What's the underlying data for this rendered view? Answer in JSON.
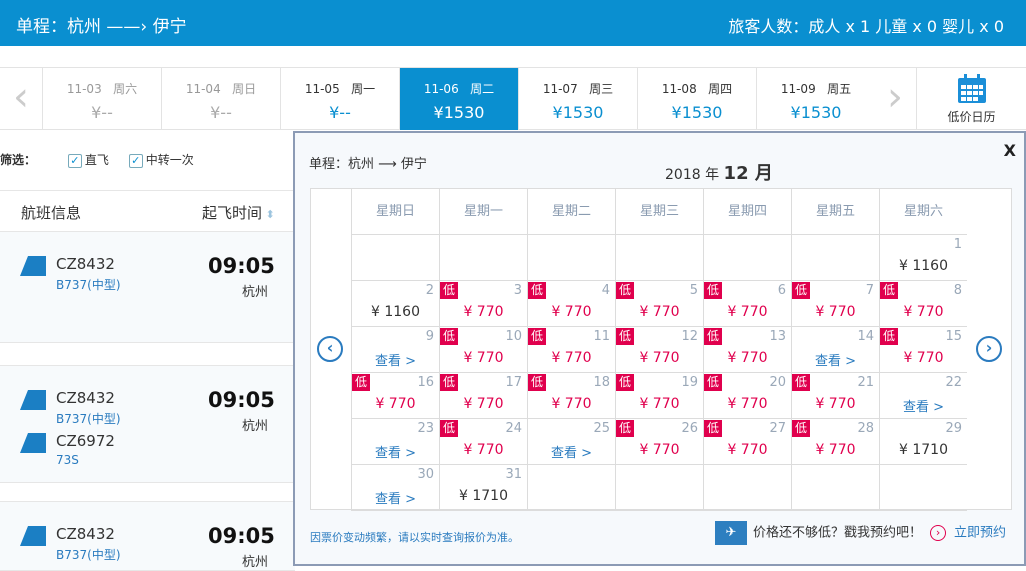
{
  "header": {
    "route": "单程：杭州 ——› 伊宁",
    "passengers": "旅客人数：成人 x 1 儿童 x 0 婴儿 x 0"
  },
  "dates": [
    {
      "date": "11-03",
      "weekday": "周六",
      "price": "¥--",
      "state": "past"
    },
    {
      "date": "11-04",
      "weekday": "周日",
      "price": "¥--",
      "state": "past"
    },
    {
      "date": "11-05",
      "weekday": "周一",
      "price": "¥--",
      "state": "norm"
    },
    {
      "date": "11-06",
      "weekday": "周二",
      "price": "¥1530",
      "state": "sel"
    },
    {
      "date": "11-07",
      "weekday": "周三",
      "price": "¥1530",
      "state": "norm"
    },
    {
      "date": "11-08",
      "weekday": "周四",
      "price": "¥1530",
      "state": "norm"
    },
    {
      "date": "11-09",
      "weekday": "周五",
      "price": "¥1530",
      "state": "norm"
    }
  ],
  "calendar_button": "低价日历",
  "filter": {
    "label": "筛选：",
    "options": [
      "直飞",
      "中转一次"
    ]
  },
  "list_header": {
    "info": "航班信息",
    "time": "起飞时间"
  },
  "flights": [
    {
      "legs": [
        {
          "no": "CZ8432",
          "type": "B737(中型)"
        }
      ],
      "time": "09:05",
      "city": "杭州"
    },
    {
      "legs": [
        {
          "no": "CZ8432",
          "type": "B737(中型)"
        },
        {
          "no": "CZ6972",
          "type": "73S"
        }
      ],
      "time": "09:05",
      "city": "杭州"
    },
    {
      "legs": [
        {
          "no": "CZ8432",
          "type": "B737(中型)"
        }
      ],
      "time": "09:05",
      "city": "杭州"
    }
  ],
  "popup": {
    "route": "单程：杭州 ⟶ 伊宁",
    "year": "2018 年",
    "month": "12 月",
    "close": "X",
    "weekdays": [
      "星期日",
      "星期一",
      "星期二",
      "星期三",
      "星期四",
      "星期五",
      "星期六"
    ],
    "low_badge": "低",
    "look": "查看 >",
    "days": [
      {
        "d": 1,
        "p": "¥ 1160",
        "k": "n"
      },
      {
        "d": 2,
        "p": "¥ 1160",
        "k": "n"
      },
      {
        "d": 3,
        "p": "¥ 770",
        "k": "low"
      },
      {
        "d": 4,
        "p": "¥ 770",
        "k": "low"
      },
      {
        "d": 5,
        "p": "¥ 770",
        "k": "low"
      },
      {
        "d": 6,
        "p": "¥ 770",
        "k": "low"
      },
      {
        "d": 7,
        "p": "¥ 770",
        "k": "low"
      },
      {
        "d": 8,
        "p": "¥ 770",
        "k": "low"
      },
      {
        "d": 9,
        "k": "look"
      },
      {
        "d": 10,
        "p": "¥ 770",
        "k": "low"
      },
      {
        "d": 11,
        "p": "¥ 770",
        "k": "low"
      },
      {
        "d": 12,
        "p": "¥ 770",
        "k": "low"
      },
      {
        "d": 13,
        "p": "¥ 770",
        "k": "low"
      },
      {
        "d": 14,
        "k": "look"
      },
      {
        "d": 15,
        "p": "¥ 770",
        "k": "low"
      },
      {
        "d": 16,
        "p": "¥ 770",
        "k": "low"
      },
      {
        "d": 17,
        "p": "¥ 770",
        "k": "low"
      },
      {
        "d": 18,
        "p": "¥ 770",
        "k": "low"
      },
      {
        "d": 19,
        "p": "¥ 770",
        "k": "low"
      },
      {
        "d": 20,
        "p": "¥ 770",
        "k": "low"
      },
      {
        "d": 21,
        "p": "¥ 770",
        "k": "low"
      },
      {
        "d": 22,
        "k": "look"
      },
      {
        "d": 23,
        "k": "look"
      },
      {
        "d": 24,
        "p": "¥ 770",
        "k": "low"
      },
      {
        "d": 25,
        "k": "look"
      },
      {
        "d": 26,
        "p": "¥ 770",
        "k": "low"
      },
      {
        "d": 27,
        "p": "¥ 770",
        "k": "low"
      },
      {
        "d": 28,
        "p": "¥ 770",
        "k": "low"
      },
      {
        "d": 29,
        "p": "¥ 1710",
        "k": "n"
      },
      {
        "d": 30,
        "k": "look"
      },
      {
        "d": 31,
        "p": "¥ 1710",
        "k": "n"
      }
    ],
    "first_weekday": 6,
    "note": "因票价变动频繁，请以实时查询报价为准。",
    "promo": "价格还不够低？戳我预约吧！",
    "promo_link": "立即预约"
  },
  "colors": {
    "brand": "#0a8fd0",
    "low": "#e0004d"
  }
}
